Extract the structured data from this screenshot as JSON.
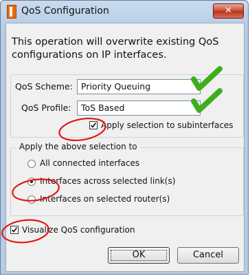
{
  "window": {
    "title": "QoS Configuration",
    "close_label": "✕",
    "accent": "#c94b33"
  },
  "message": "This operation will overwrite existing QoS configurations on IP interfaces.",
  "qos": {
    "scheme_label": "QoS Scheme:",
    "scheme_value": "Priority Queuing",
    "profile_label": "QoS Profile:",
    "profile_value": "ToS Based",
    "apply_sub_label": "Apply selection to subinterfaces",
    "apply_sub_checked": true
  },
  "scope": {
    "legend": "Apply the above selection to",
    "options": [
      {
        "label": "All connected interfaces",
        "selected": false
      },
      {
        "label": "Interfaces across selected link(s)",
        "selected": true
      },
      {
        "label": "Interfaces on selected router(s)",
        "selected": false
      }
    ]
  },
  "visualize": {
    "label": "Visualize QoS configuration",
    "checked": true
  },
  "buttons": {
    "ok": "OK",
    "cancel": "Cancel"
  },
  "annotation_colors": {
    "checkmark": "#3eae1c",
    "circle": "#e01818"
  }
}
